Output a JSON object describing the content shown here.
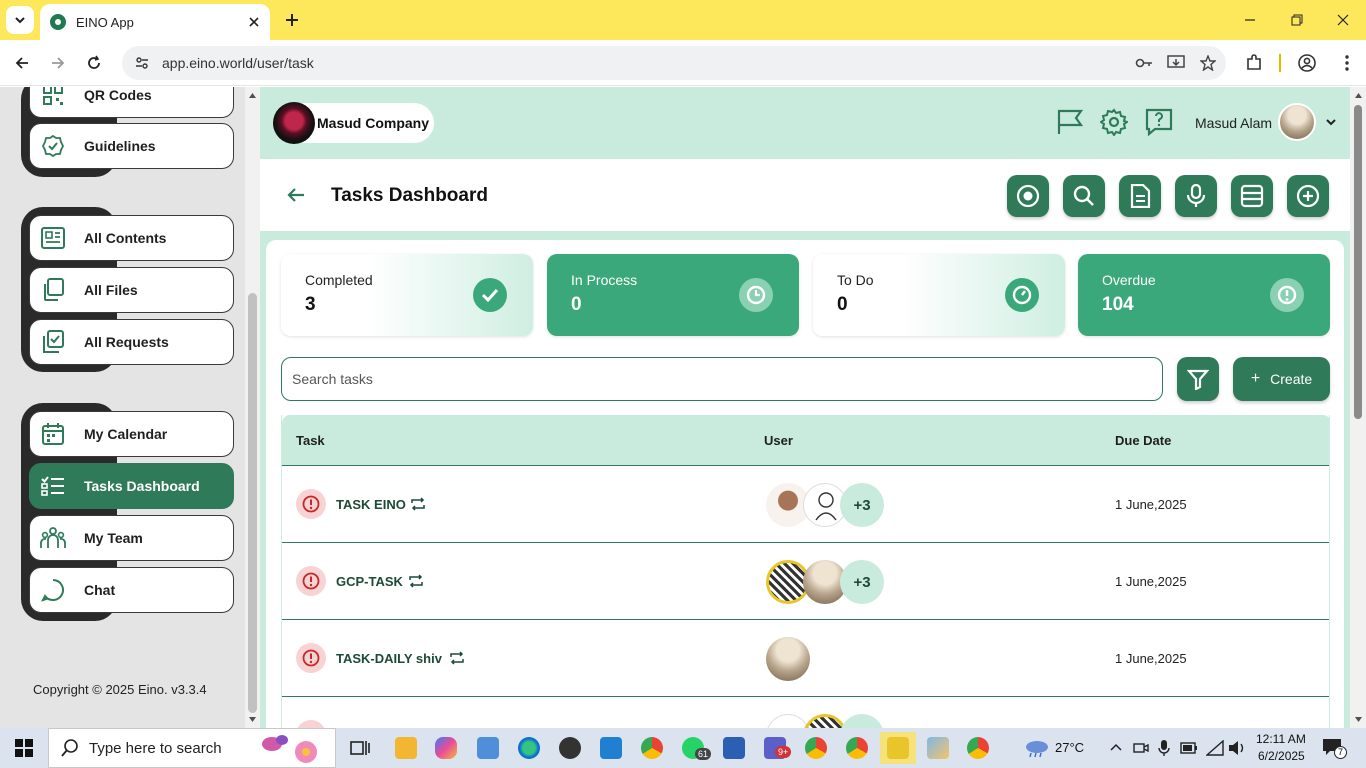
{
  "browser": {
    "tab_title": "EINO App",
    "url": "app.eino.world/user/task"
  },
  "sidebar": {
    "items": [
      {
        "label": "QR Codes",
        "icon": "qr-icon"
      },
      {
        "label": "Guidelines",
        "icon": "check-badge-icon"
      },
      {
        "label": "All Contents",
        "icon": "content-icon"
      },
      {
        "label": "All Files",
        "icon": "files-icon"
      },
      {
        "label": "All Requests",
        "icon": "requests-icon"
      },
      {
        "label": "My Calendar",
        "icon": "calendar-icon"
      },
      {
        "label": "Tasks Dashboard",
        "icon": "tasks-icon"
      },
      {
        "label": "My Team",
        "icon": "team-icon"
      },
      {
        "label": "Chat",
        "icon": "chat-icon"
      }
    ],
    "active": "Tasks Dashboard",
    "copyright": "Copyright © 2025 Eino. v3.3.4"
  },
  "header": {
    "company": "Masud Company",
    "user": "Masud Alam"
  },
  "page": {
    "title": "Tasks Dashboard"
  },
  "stats": [
    {
      "label": "Completed",
      "value": "3"
    },
    {
      "label": "In Process",
      "value": "0"
    },
    {
      "label": "To Do",
      "value": "0"
    },
    {
      "label": "Overdue",
      "value": "104"
    }
  ],
  "search": {
    "placeholder": "Search tasks"
  },
  "create_label": "Create",
  "table": {
    "headers": {
      "task": "Task",
      "user": "User",
      "due": "Due Date"
    },
    "rows": [
      {
        "task": "TASK EINO",
        "extra": "+3",
        "due": "1 June,2025"
      },
      {
        "task": "GCP-TASK",
        "extra": "+3",
        "due": "1 June,2025"
      },
      {
        "task": "TASK-DAILY shiv",
        "extra": "",
        "due": "1 June,2025"
      }
    ]
  },
  "taskbar": {
    "search_placeholder": "Type here to search",
    "weather": "27°C",
    "time": "12:11 AM",
    "date": "6/2/2025",
    "badge_whatsapp": "61",
    "badge_teams": "9+",
    "notifications": "7"
  },
  "colors": {
    "brand": "#2f7a58",
    "accent": "#3aa87a",
    "header_bg": "#c9ebde",
    "tab_bar": "#fde75a"
  }
}
